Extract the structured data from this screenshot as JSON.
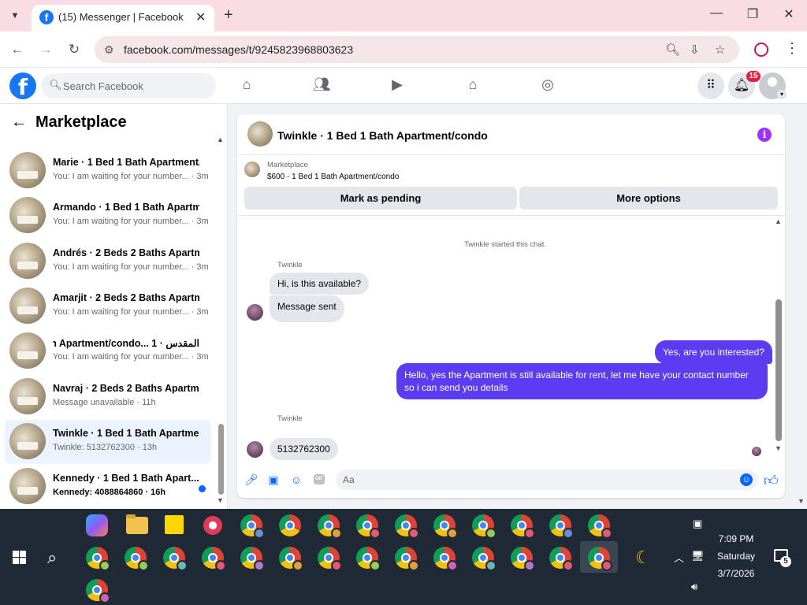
{
  "browser": {
    "tab_title": "(15) Messenger | Facebook",
    "tab_favicon": "f",
    "url": "facebook.com/messages/t/9245823968803623"
  },
  "fb": {
    "logo_letter": "f",
    "search_placeholder": "Search Facebook",
    "notification_count": "15"
  },
  "sidebar": {
    "title": "Marketplace",
    "conversations": [
      {
        "name": "Marie · 1 Bed 1 Bath Apartment/...",
        "preview": "You: I am waiting for your number... · 3m"
      },
      {
        "name": "Armando · 1 Bed 1 Bath Apartm...",
        "preview": "You: I am waiting for your number... · 3m"
      },
      {
        "name": "Andrés · 2 Beds 2 Baths Apartm...",
        "preview": "You: I am waiting for your number... · 3m"
      },
      {
        "name": "Amarjit · 2 Beds 2 Baths Apartm...",
        "preview": "You: I am waiting for your number... · 3m"
      },
      {
        "name": "المقدس · 1 ...th Apartment/condo",
        "preview": "You: I am waiting for your number... · 3m"
      },
      {
        "name": "Navraj · 2 Beds 2 Baths Apartm...",
        "preview": "Message unavailable · 11h"
      },
      {
        "name": "Twinkle · 1 Bed 1 Bath Apartmen...",
        "preview": "Twinkle: 5132762300 · 13h"
      },
      {
        "name": "Kennedy · 1 Bed 1 Bath Apart...",
        "preview": "Kennedy: 4088864860 · 16h"
      }
    ]
  },
  "chat": {
    "title": "Twinkle · 1 Bed 1 Bath Apartment/condo",
    "info_icon": "i",
    "marketplace_label": "Marketplace",
    "listing": "$600 - 1 Bed 1 Bath Apartment/condo",
    "mark_pending": "Mark as pending",
    "more_options": "More options",
    "system_message": "Twinkle started this chat.",
    "sender_name": "Twinkle",
    "sender_name_2": "Twinkle",
    "msg1": "Hi, is this available?",
    "msg2": "Message sent",
    "msg3": "Yes, are you interested?",
    "msg4": "Hello, yes the Apartment is still available for rent, let me have your contact number so i can send you details",
    "msg5": "5132762300",
    "composer_placeholder": "Aa"
  },
  "taskbar": {
    "time": "7:09 PM",
    "day": "Saturday",
    "date": "3/7/2026",
    "notifications": "5"
  }
}
